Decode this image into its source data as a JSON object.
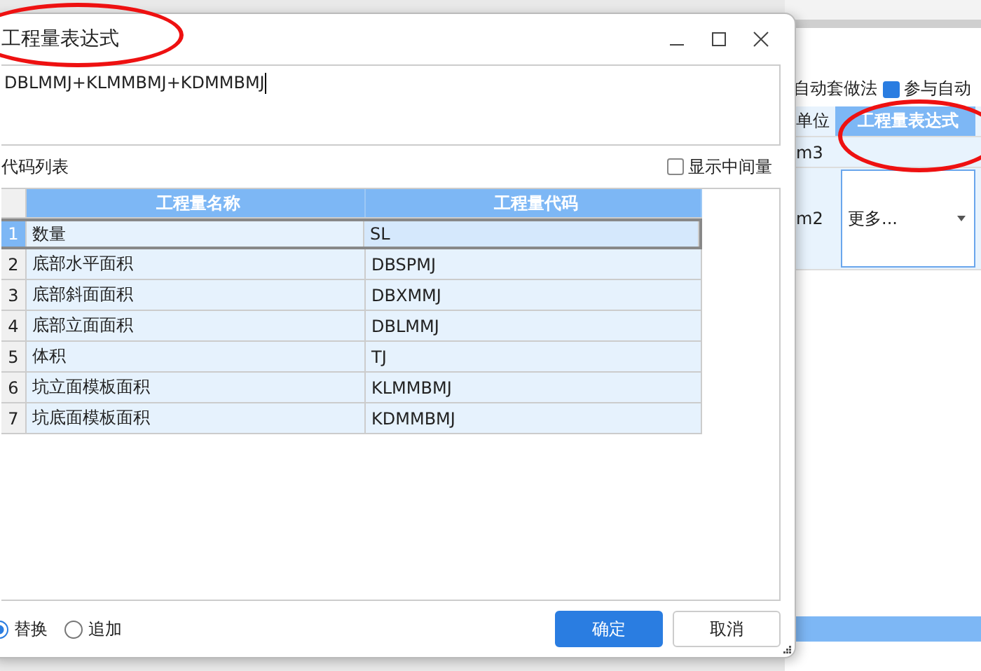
{
  "background": {
    "auto_label": "自动套做法",
    "participate": {
      "label": "参与自动",
      "checked": true
    },
    "columns": [
      "单位",
      "工程量表达式"
    ],
    "rows": [
      {
        "unit": "m3"
      },
      {
        "unit": "m2",
        "dropdown": "更多..."
      }
    ]
  },
  "dialog": {
    "title": "工程量表达式",
    "expression": "DBLMMJ+KLMMBMJ+KDMMBMJ",
    "list_label": "代码列表",
    "show_intermediate": {
      "label": "显示中间量",
      "checked": false
    },
    "table": {
      "columns": [
        "工程量名称",
        "工程量代码"
      ],
      "rows": [
        {
          "index": "1",
          "name": "数量",
          "code": "SL",
          "selected": true
        },
        {
          "index": "2",
          "name": "底部水平面积",
          "code": "DBSPMJ",
          "selected": false
        },
        {
          "index": "3",
          "name": "底部斜面面积",
          "code": "DBXMMJ",
          "selected": false
        },
        {
          "index": "4",
          "name": "底部立面面积",
          "code": "DBLMMJ",
          "selected": false
        },
        {
          "index": "5",
          "name": "体积",
          "code": "TJ",
          "selected": false
        },
        {
          "index": "6",
          "name": "坑立面模板面积",
          "code": "KLMMBMJ",
          "selected": false
        },
        {
          "index": "7",
          "name": "坑底面模板面积",
          "code": "KDMMBMJ",
          "selected": false
        }
      ]
    },
    "modes": [
      {
        "label": "替换",
        "selected": true
      },
      {
        "label": "追加",
        "selected": false
      }
    ],
    "buttons": [
      {
        "label": "确定",
        "kind": "primary"
      },
      {
        "label": "取消",
        "kind": "secondary"
      }
    ]
  },
  "annotations": [
    {
      "kind": "ellipse"
    },
    {
      "kind": "ellipse"
    }
  ]
}
